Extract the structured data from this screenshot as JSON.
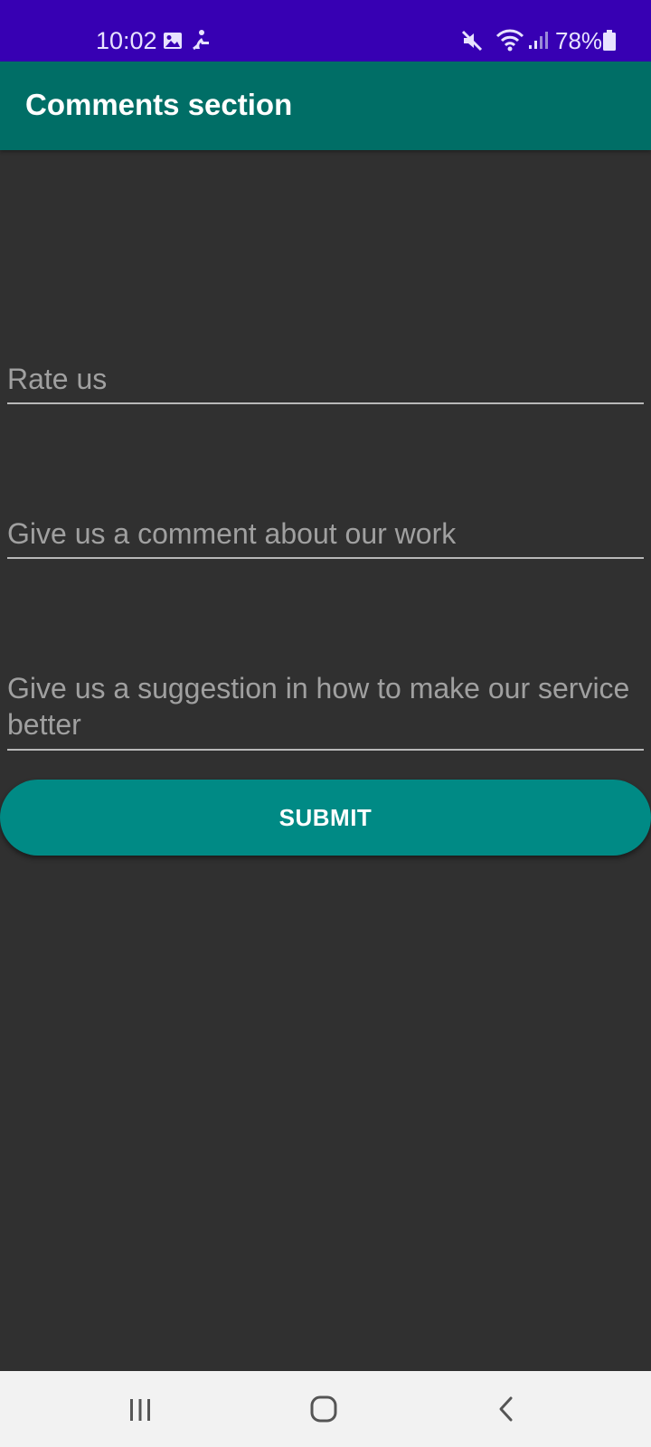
{
  "status_bar": {
    "time": "10:02",
    "battery": "78%",
    "icons": [
      "gallery-icon",
      "activity-icon",
      "mute-icon",
      "wifi-icon",
      "signal-icon",
      "battery-icon"
    ]
  },
  "app_bar": {
    "title": "Comments section"
  },
  "form": {
    "rate_placeholder": "Rate us",
    "comment_placeholder": "Give us a comment about our work",
    "suggestion_placeholder": "Give us a suggestion in how to make our service better",
    "submit_label": "SUBMIT"
  },
  "nav_bar": {
    "icons": [
      "recent-apps-icon",
      "home-icon",
      "back-icon"
    ]
  },
  "colors": {
    "status_bar": "#3700b3",
    "app_bar": "#006e66",
    "background": "#303030",
    "button": "#008a85",
    "nav_bar": "#f2f2f2"
  }
}
